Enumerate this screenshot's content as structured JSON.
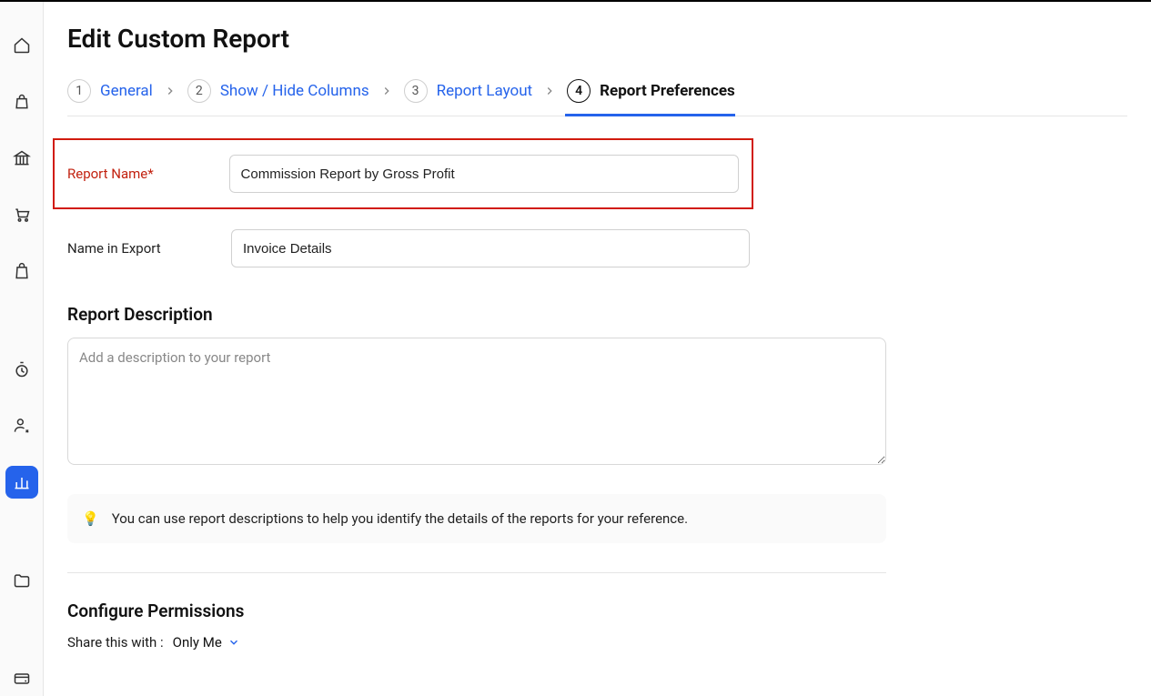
{
  "page": {
    "title": "Edit Custom Report"
  },
  "steps": [
    {
      "num": "1",
      "label": "General"
    },
    {
      "num": "2",
      "label": "Show / Hide Columns"
    },
    {
      "num": "3",
      "label": "Report Layout"
    },
    {
      "num": "4",
      "label": "Report Preferences"
    }
  ],
  "form": {
    "report_name_label": "Report Name*",
    "report_name_value": "Commission Report by Gross Profit",
    "name_in_export_label": "Name in Export",
    "name_in_export_value": "Invoice Details",
    "description_heading": "Report Description",
    "description_placeholder": "Add a description to your report",
    "tip_icon": "💡",
    "tip_text": "You can use report descriptions to help you identify the details of the reports for your reference.",
    "permissions_heading": "Configure Permissions",
    "share_label": "Share this with :",
    "share_value": "Only Me"
  }
}
